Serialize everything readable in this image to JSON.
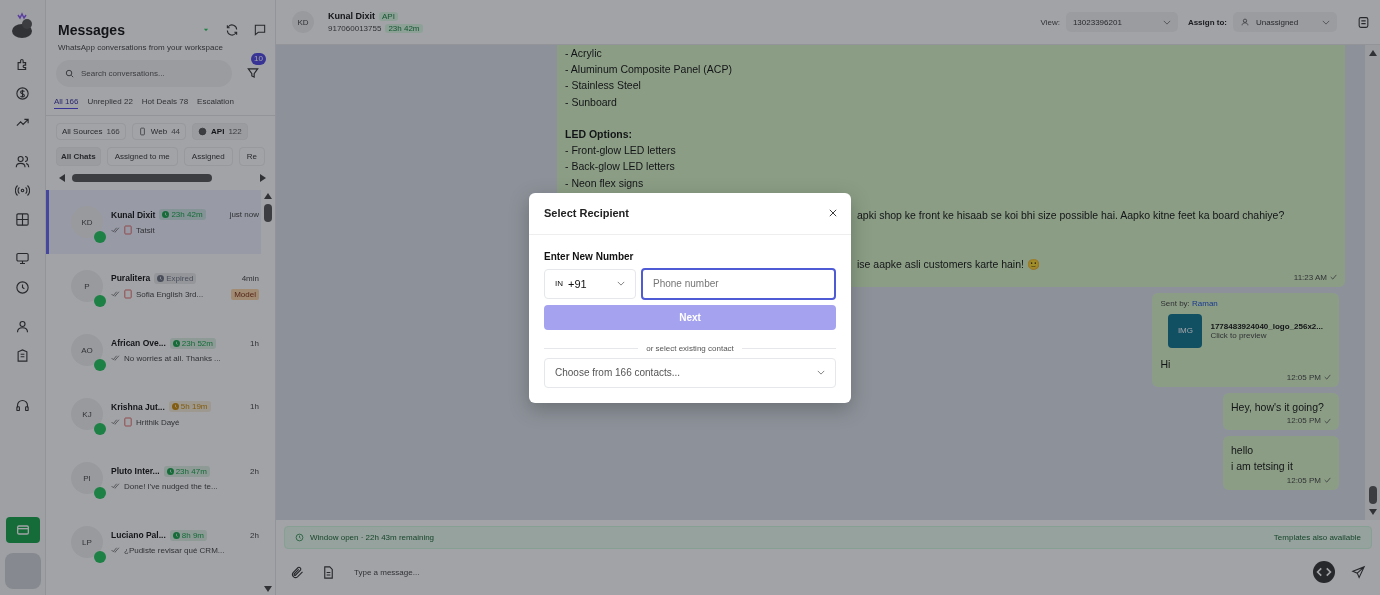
{
  "sidebar": {
    "title": "Messages",
    "subtitle": "WhatsApp conversations from your workspace",
    "search": {
      "placeholder": "Search conversations..."
    },
    "filter_badge": "10",
    "tabs": [
      {
        "label": "All 166",
        "selected": true
      },
      {
        "label": "Unreplied 22",
        "selected": false
      },
      {
        "label": "Hot Deals 78",
        "selected": false
      },
      {
        "label": "Escalation",
        "selected": false
      }
    ],
    "sources": [
      {
        "label": "All Sources",
        "count": "166",
        "kind": "all",
        "selected": false
      },
      {
        "label": "Web",
        "count": "44",
        "kind": "web",
        "selected": false
      },
      {
        "label": "API",
        "count": "122",
        "kind": "api",
        "selected": true
      }
    ],
    "chat_filters": [
      {
        "label": "All Chats",
        "selected": true
      },
      {
        "label": "Assigned to me",
        "selected": false
      },
      {
        "label": "Assigned",
        "selected": false
      },
      {
        "label": "Re",
        "selected": false
      }
    ],
    "conversations": [
      {
        "initials": "KD",
        "name": "Kunal Dixit",
        "badge": {
          "text": "23h 42m",
          "kind": "active"
        },
        "time": "just now",
        "preview": "Tatsit",
        "attachment": true,
        "selected": true
      },
      {
        "initials": "P",
        "name": "Puralitera",
        "badge": {
          "text": "Expired",
          "kind": "expired"
        },
        "time": "4min",
        "preview": "Sofia English 3rd...",
        "attachment": true,
        "tag": "Model",
        "selected": false
      },
      {
        "initials": "AO",
        "name": "African Ove...",
        "badge": {
          "text": "23h 52m",
          "kind": "active"
        },
        "time": "1h",
        "preview": "No worries at all. Thanks ...",
        "attachment": false,
        "selected": false
      },
      {
        "initials": "KJ",
        "name": "Krishna Jut...",
        "badge": {
          "text": "5h 19m",
          "kind": "warning"
        },
        "time": "1h",
        "preview": "Hrithik Dayé",
        "attachment": true,
        "selected": false
      },
      {
        "initials": "PI",
        "name": "Pluto Inter...",
        "badge": {
          "text": "23h 47m",
          "kind": "active"
        },
        "time": "2h",
        "preview": "Done! I've nudged the te...",
        "attachment": false,
        "selected": false
      },
      {
        "initials": "LP",
        "name": "Luciano Pal...",
        "badge": {
          "text": "8h 9m",
          "kind": "active"
        },
        "time": "2h",
        "preview": "¿Pudiste revisar qué CRM...",
        "attachment": false,
        "selected": false
      }
    ]
  },
  "chat_header": {
    "initials": "KD",
    "name": "Kunal Dixit",
    "source": "API",
    "phone": "917060013755",
    "timer": "23h 42m",
    "view_label": "View:",
    "view_value": "13023396201",
    "assign_label": "Assign to:",
    "assign_value": "Unassigned"
  },
  "messages": [
    {
      "kind": "text",
      "outgoing": false,
      "lines": [
        {
          "kind": "line",
          "text": "- Acrylic"
        },
        {
          "kind": "line",
          "text": "- Aluminum Composite Panel (ACP)"
        },
        {
          "kind": "line",
          "text": "- Stainless Steel"
        },
        {
          "kind": "line",
          "text": "- Sunboard"
        },
        {
          "kind": "gap"
        },
        {
          "kind": "line",
          "text": "**LED Options:**"
        },
        {
          "kind": "line",
          "text": "- Front-glow LED letters"
        },
        {
          "kind": "line",
          "text": "- Back-glow LED letters"
        },
        {
          "kind": "line",
          "text": "- Neon flex signs"
        },
        {
          "kind": "gap"
        },
        {
          "kind": "cut",
          "text": "apki shop ke front ke hisaab se koi bhi size possible hai. Aapko kitne feet ka board chahiye?"
        },
        {
          "kind": "gap"
        },
        {
          "kind": "gap"
        },
        {
          "kind": "cut",
          "text": "ise aapke asli customers karte hain! 🙂"
        }
      ],
      "time": "11:23 AM"
    },
    {
      "kind": "file",
      "outgoing": true,
      "sender_label": "Sent by:",
      "sender": "Raman",
      "file_icon": "IMG",
      "file_name": "1778483924040_logo_256x2...",
      "file_hint": "Click to preview",
      "lines": [
        {
          "kind": "line",
          "text": "Hi"
        }
      ],
      "time": "12:05 PM"
    },
    {
      "kind": "text",
      "outgoing": true,
      "lines": [
        {
          "kind": "line",
          "text": "Hey, how's it going?"
        }
      ],
      "time": "12:05 PM"
    },
    {
      "kind": "text",
      "outgoing": true,
      "lines": [
        {
          "kind": "line",
          "text": "hello"
        },
        {
          "kind": "line",
          "text": "i am tetsing it"
        }
      ],
      "time": "12:05 PM"
    }
  ],
  "window_banner": {
    "text": "Window open · 22h 43m remaining",
    "note": "Templates also available"
  },
  "composer": {
    "placeholder": "Type a message..."
  },
  "dialog": {
    "title": "Select Recipient",
    "section_label": "Enter New Number",
    "country_code": "IN",
    "dial_code": "+91",
    "phone": {
      "placeholder": "Phone number"
    },
    "next_label": "Next",
    "next_disabled": true,
    "divider_text": "or select existing contact",
    "contact_select": {
      "placeholder": "Choose from 166 contacts..."
    }
  }
}
